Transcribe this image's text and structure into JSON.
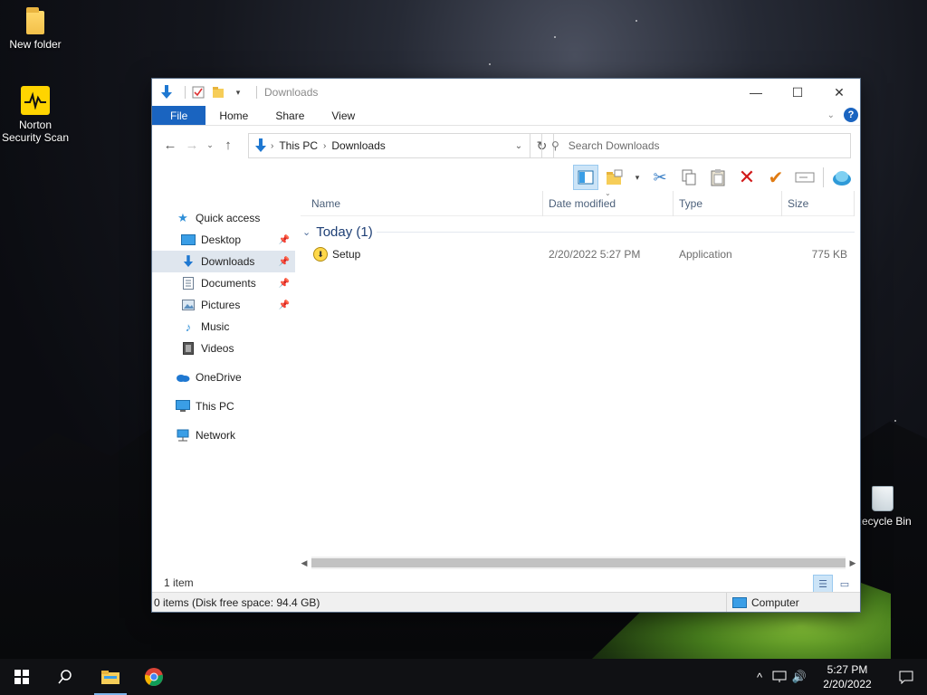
{
  "desktop": {
    "icons": [
      {
        "label": "New folder",
        "icon": "folder-icon"
      },
      {
        "label": "Norton Security Scan",
        "icon": "norton-icon"
      },
      {
        "label": "Recycle Bin",
        "icon": "recycle-bin-icon"
      }
    ]
  },
  "window": {
    "title": "Downloads",
    "controls": {
      "minimize": "—",
      "maximize": "☐",
      "close": "✕"
    }
  },
  "ribbon": {
    "tabs": [
      {
        "label": "File",
        "active": true
      },
      {
        "label": "Home"
      },
      {
        "label": "Share"
      },
      {
        "label": "View"
      }
    ]
  },
  "address": {
    "crumbs": [
      "This PC",
      "Downloads"
    ],
    "search_placeholder": "Search Downloads"
  },
  "toolbar": {
    "buttons": [
      "preview-pane-icon",
      "new-folder-icon",
      "cut-icon",
      "copy-icon",
      "paste-icon",
      "delete-icon",
      "checkmark-icon",
      "rename-icon",
      "globe-icon"
    ]
  },
  "navpane": {
    "quick_access": "Quick access",
    "pinned": [
      {
        "label": "Desktop",
        "pinned": true
      },
      {
        "label": "Downloads",
        "pinned": true,
        "selected": true
      },
      {
        "label": "Documents",
        "pinned": true
      },
      {
        "label": "Pictures",
        "pinned": true
      },
      {
        "label": "Music",
        "pinned": false
      },
      {
        "label": "Videos",
        "pinned": false
      }
    ],
    "onedrive": "OneDrive",
    "thispc": "This PC",
    "network": "Network"
  },
  "columns": {
    "name": "Name",
    "date_modified": "Date modified",
    "type": "Type",
    "size": "Size"
  },
  "group": {
    "label": "Today (1)"
  },
  "files": [
    {
      "name": "Setup",
      "date_modified": "2/20/2022 5:27 PM",
      "type": "Application",
      "size": "775 KB"
    }
  ],
  "status": {
    "item_count": "1 item",
    "details": "0 items (Disk free space: 94.4 GB)",
    "location": "Computer"
  },
  "taskbar": {
    "time": "5:27 PM",
    "date": "2/20/2022"
  }
}
